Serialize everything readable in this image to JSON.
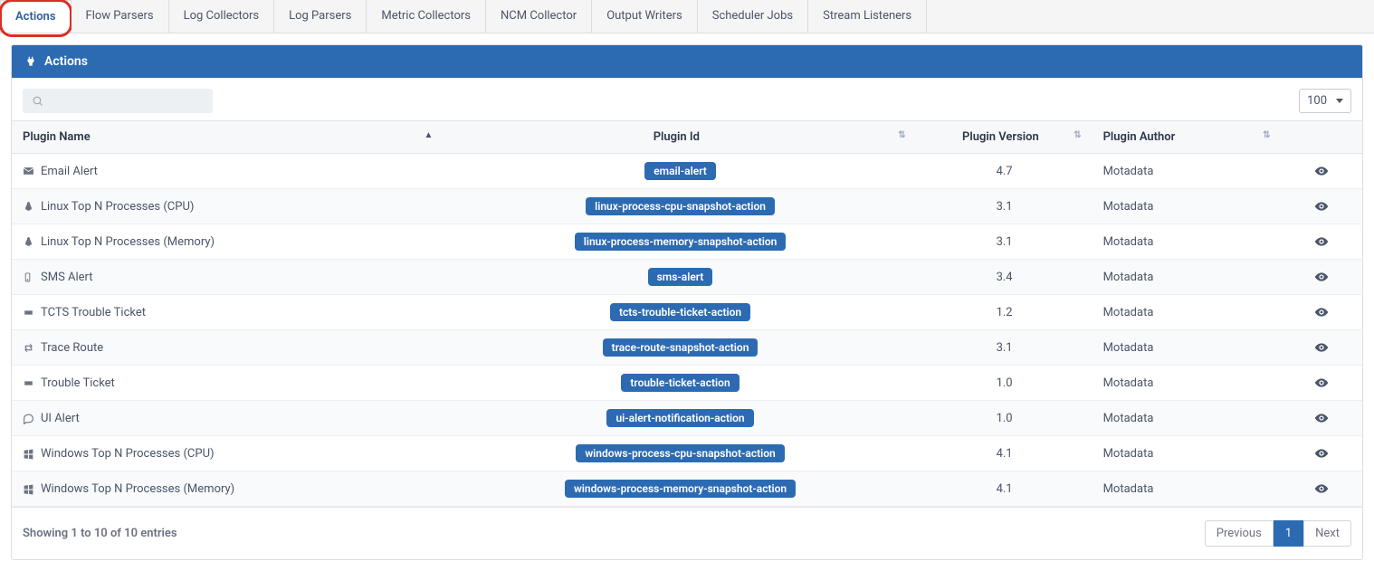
{
  "tabs": [
    {
      "label": "Actions",
      "active": true
    },
    {
      "label": "Flow Parsers",
      "active": false
    },
    {
      "label": "Log Collectors",
      "active": false
    },
    {
      "label": "Log Parsers",
      "active": false
    },
    {
      "label": "Metric Collectors",
      "active": false
    },
    {
      "label": "NCM Collector",
      "active": false
    },
    {
      "label": "Output Writers",
      "active": false
    },
    {
      "label": "Scheduler Jobs",
      "active": false
    },
    {
      "label": "Stream Listeners",
      "active": false
    }
  ],
  "panel": {
    "title": "Actions"
  },
  "search": {
    "placeholder": ""
  },
  "page_size": {
    "value": "100"
  },
  "columns": {
    "name": "Plugin Name",
    "id": "Plugin Id",
    "version": "Plugin Version",
    "author": "Plugin Author"
  },
  "rows": [
    {
      "icon": "envelope",
      "name": "Email Alert",
      "id": "email-alert",
      "version": "4.7",
      "author": "Motadata"
    },
    {
      "icon": "linux",
      "name": "Linux Top N Processes (CPU)",
      "id": "linux-process-cpu-snapshot-action",
      "version": "3.1",
      "author": "Motadata"
    },
    {
      "icon": "linux",
      "name": "Linux Top N Processes (Memory)",
      "id": "linux-process-memory-snapshot-action",
      "version": "3.1",
      "author": "Motadata"
    },
    {
      "icon": "mobile",
      "name": "SMS Alert",
      "id": "sms-alert",
      "version": "3.4",
      "author": "Motadata"
    },
    {
      "icon": "ticket",
      "name": "TCTS Trouble Ticket",
      "id": "tcts-trouble-ticket-action",
      "version": "1.2",
      "author": "Motadata"
    },
    {
      "icon": "retweet",
      "name": "Trace Route",
      "id": "trace-route-snapshot-action",
      "version": "3.1",
      "author": "Motadata"
    },
    {
      "icon": "ticket",
      "name": "Trouble Ticket",
      "id": "trouble-ticket-action",
      "version": "1.0",
      "author": "Motadata"
    },
    {
      "icon": "comment",
      "name": "UI Alert",
      "id": "ui-alert-notification-action",
      "version": "1.0",
      "author": "Motadata"
    },
    {
      "icon": "windows",
      "name": "Windows Top N Processes (CPU)",
      "id": "windows-process-cpu-snapshot-action",
      "version": "4.1",
      "author": "Motadata"
    },
    {
      "icon": "windows",
      "name": "Windows Top N Processes (Memory)",
      "id": "windows-process-memory-snapshot-action",
      "version": "4.1",
      "author": "Motadata"
    }
  ],
  "footer": {
    "text": "Showing 1 to 10 of 10 entries",
    "prev": "Previous",
    "page": "1",
    "next": "Next"
  }
}
